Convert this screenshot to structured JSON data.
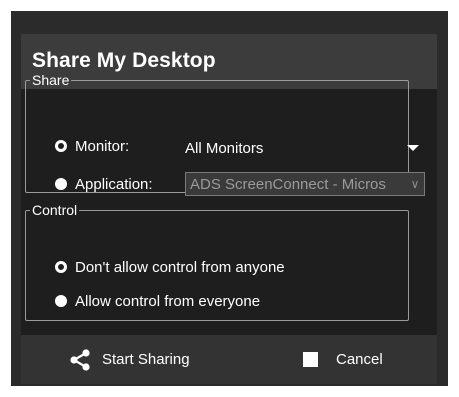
{
  "dialog": {
    "title": "Share My Desktop"
  },
  "share_group": {
    "legend": "Share",
    "monitor": {
      "label": "Monitor:",
      "selected": true,
      "value": "All Monitors"
    },
    "application": {
      "label": "Application:",
      "selected": false,
      "value": "ADS ScreenConnect - Micros"
    }
  },
  "control_group": {
    "legend": "Control",
    "options": [
      {
        "label": "Don't allow control from anyone",
        "selected": true
      },
      {
        "label": "Allow control from everyone",
        "selected": false
      }
    ]
  },
  "footer": {
    "start_label": "Start Sharing",
    "cancel_label": "Cancel"
  },
  "icons": {
    "start": "share-icon",
    "cancel": "stop-square-icon",
    "monitor_caret": "caret-down-icon",
    "app_caret": "chevron-down-icon"
  }
}
